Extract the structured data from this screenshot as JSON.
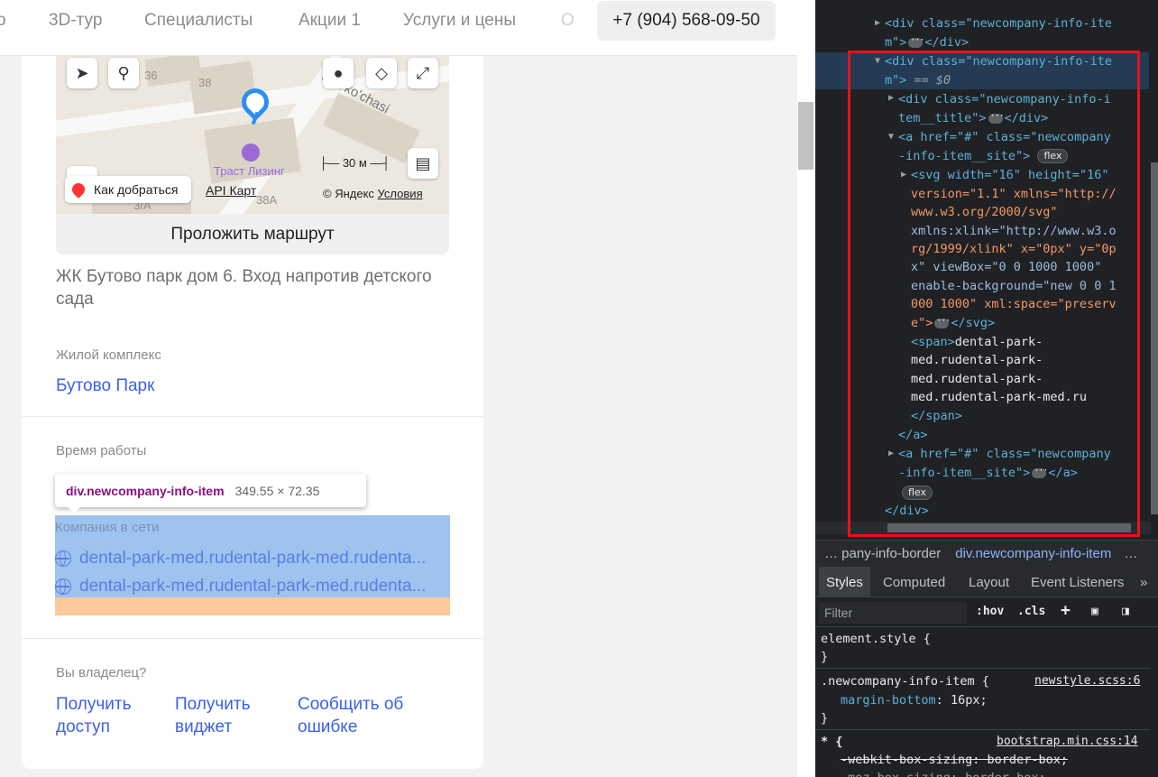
{
  "nav": {
    "items": [
      "о",
      "3D-тур",
      "Специалисты",
      "Акции 1",
      "Услуги и цены",
      "О"
    ],
    "phone": "+7 (904) 568-09-50"
  },
  "map": {
    "numbers": [
      "36",
      "38",
      "38A"
    ],
    "partial_number": "3/A",
    "street": "bek ko'chasi",
    "poi": "Траст Лизинг",
    "scale": "30 м",
    "route_chip": "Как добраться",
    "api_link": "API Карт",
    "copyright": "© Яндекс",
    "terms": "Условия"
  },
  "route_button": "Проложить маршрут",
  "address": "ЖК Бутово парк дом 6. Вход напротив детского сада",
  "complex": {
    "label": "Жилой комплекс",
    "value": "Бутово Парк"
  },
  "hours": {
    "label": "Время работы",
    "partial": ")"
  },
  "tooltip": {
    "selector": "div.newcompany-info-item",
    "dims": "349.55 × 72.35"
  },
  "online": {
    "label": "Компания в сети",
    "sites": [
      "dental-park-med.rudental-park-med.rudenta...",
      "dental-park-med.rudental-park-med.rudenta..."
    ]
  },
  "owner": {
    "label": "Вы владелец?",
    "links": [
      [
        "Получить",
        "доступ"
      ],
      [
        "Получить",
        "виджет"
      ],
      [
        "Сообщить об",
        "ошибке"
      ]
    ]
  },
  "devtools": {
    "dom": {
      "l1a": "<div class=\"newcompany-info-ite",
      "l1b": "m\">",
      "l1c": "</div>",
      "l2a": "<div class=\"newcompany-info-ite",
      "l2b": "m\">",
      "l2c": "== $0",
      "l3a": "<div class=\"newcompany-info-i",
      "l3b": "tem__title\">",
      "l3c": "</div>",
      "l4a": "<a href=\"#\" class=\"newcompany",
      "l4b": "-info-item__site\">",
      "flex": "flex",
      "svg1": "<svg width=\"16\" height=\"16\"",
      "svg2": "version=\"1.1\" xmlns=\"http://",
      "svg3": "www.w3.org/2000/svg\"",
      "svg4": "xmlns:xlink=\"http://www.w3.o",
      "svg5": "rg/1999/xlink\" x=\"0px\" y=\"0p",
      "svg6": "x\" viewBox=\"0 0 1000 1000\"",
      "svg7": "enable-background=\"new 0 0 1",
      "svg8": "000 1000\" xml:space=\"preserv",
      "svg9a": "e\">",
      "svg9b": "</svg>",
      "span_open": "<span>",
      "span_t1": "dental-park-",
      "span_t2": "med.rudental-park-",
      "span_t3": "med.rudental-park-",
      "span_t4": "med.rudental-park-med.ru",
      "span_close": "</span>",
      "a_close": "</a>",
      "l5a": "<a href=\"#\" class=\"newcompany",
      "l5b": "-info-item__site\">",
      "l5c": "</a>",
      "div_close": "</div>"
    },
    "breadcrumbs": [
      "… pany-info-border",
      "div.newcompany-info-item",
      "…"
    ],
    "tabs": [
      "Styles",
      "Computed",
      "Layout",
      "Event Listeners",
      "»"
    ],
    "filter": {
      "placeholder": "Filter",
      "hov": ":hov",
      "cls": ".cls",
      "plus": "+"
    },
    "styles": {
      "element_style": "element.style {",
      "close": "}",
      "rule1_selector": ".newcompany-info-item {",
      "rule1_source": "newstyle.scss:6",
      "rule1_prop": "margin-bottom",
      "rule1_value": "16px;",
      "rule2_selector": "* {",
      "rule2_source": "bootstrap.min.css:14",
      "rule2_line1": "-webkit-box-sizing: border-box;",
      "rule2_line2": "-moz-box-sizing: border-box;"
    }
  },
  "colors": {
    "link": "#3a5ff0",
    "highlight_content": "#9ec3ee",
    "highlight_margin": "#fbc99a",
    "devtools_bg": "#202124",
    "red_outline": "#e8121a"
  }
}
